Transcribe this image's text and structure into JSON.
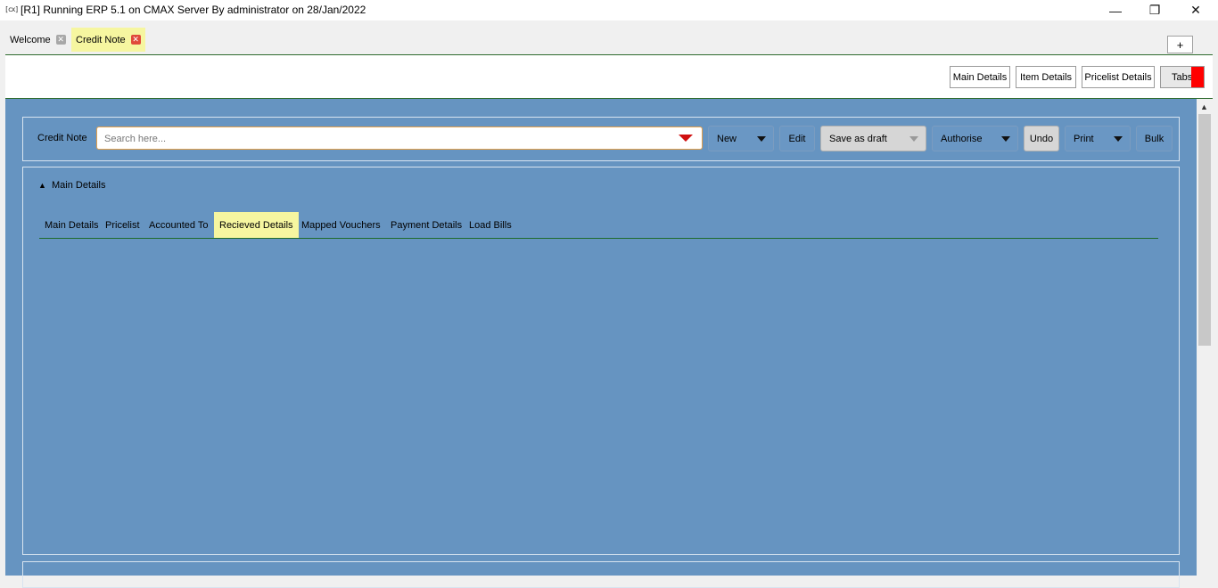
{
  "window": {
    "app_icon_text": "[cx]",
    "title": "[R1] Running ERP 5.1 on CMAX Server By administrator on 28/Jan/2022",
    "minimize_glyph": "—",
    "maximize_glyph": "❐",
    "close_glyph": "✕"
  },
  "doc_tabs": [
    {
      "label": "Welcome",
      "close_glyph": "✕"
    },
    {
      "label": "Credit Note",
      "close_glyph": "✕"
    }
  ],
  "add_tab_label": "+",
  "top_toolbar": {
    "main_details": "Main Details",
    "item_details": "Item Details",
    "pricelist_details": "Pricelist Details",
    "tabs": "Tabs"
  },
  "credit_note": {
    "label": "Credit Note",
    "search_placeholder": "Search here..."
  },
  "actions": {
    "new": "New",
    "edit": "Edit",
    "save_as_draft": "Save as draft",
    "authorise": "Authorise",
    "undo": "Undo",
    "print": "Print",
    "bulk": "Bulk"
  },
  "main_section": {
    "toggle_glyph": "▲",
    "title": "Main Details",
    "tabs": [
      "Main Details",
      "Pricelist",
      "Accounted To",
      "Recieved Details",
      "Mapped Vouchers",
      "Payment Details",
      "Load Bills"
    ],
    "active_tab": "Recieved Details"
  },
  "colors": {
    "workspace_blue": "#6694c1",
    "active_tab_yellow": "#f6f6a0",
    "divider_green": "#2e6b2e",
    "search_arrow_red": "#d01010",
    "tabs_marker_red": "#ff0000"
  }
}
